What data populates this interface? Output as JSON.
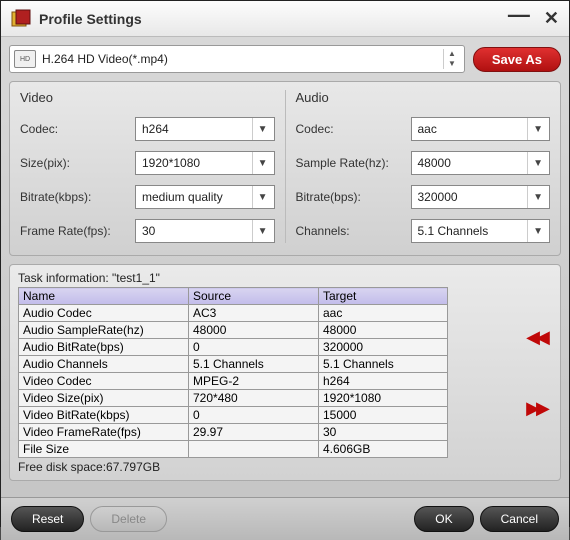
{
  "window": {
    "title": "Profile Settings"
  },
  "profile": {
    "selected": "H.264 HD Video(*.mp4)",
    "icon_label": "HD"
  },
  "buttons": {
    "save_as": "Save As",
    "reset": "Reset",
    "delete": "Delete",
    "ok": "OK",
    "cancel": "Cancel"
  },
  "video": {
    "header": "Video",
    "codec_label": "Codec:",
    "codec": "h264",
    "size_label": "Size(pix):",
    "size": "1920*1080",
    "bitrate_label": "Bitrate(kbps):",
    "bitrate": "medium quality",
    "framerate_label": "Frame Rate(fps):",
    "framerate": "30"
  },
  "audio": {
    "header": "Audio",
    "codec_label": "Codec:",
    "codec": "aac",
    "samplerate_label": "Sample Rate(hz):",
    "samplerate": "48000",
    "bitrate_label": "Bitrate(bps):",
    "bitrate": "320000",
    "channels_label": "Channels:",
    "channels": "5.1 Channels"
  },
  "task": {
    "title": "Task information: \"test1_1\"",
    "headers": [
      "Name",
      "Source",
      "Target"
    ],
    "rows": [
      {
        "name": "Audio Codec",
        "source": "AC3",
        "target": "aac"
      },
      {
        "name": "Audio SampleRate(hz)",
        "source": "48000",
        "target": "48000"
      },
      {
        "name": "Audio BitRate(bps)",
        "source": "0",
        "target": "320000"
      },
      {
        "name": "Audio Channels",
        "source": "5.1 Channels",
        "target": "5.1 Channels"
      },
      {
        "name": "Video Codec",
        "source": "MPEG-2",
        "target": "h264"
      },
      {
        "name": "Video Size(pix)",
        "source": "720*480",
        "target": "1920*1080"
      },
      {
        "name": "Video BitRate(kbps)",
        "source": "0",
        "target": "15000"
      },
      {
        "name": "Video FrameRate(fps)",
        "source": "29.97",
        "target": "30"
      },
      {
        "name": "File Size",
        "source": "",
        "target": "4.606GB"
      }
    ],
    "free_space": "Free disk space:67.797GB"
  }
}
